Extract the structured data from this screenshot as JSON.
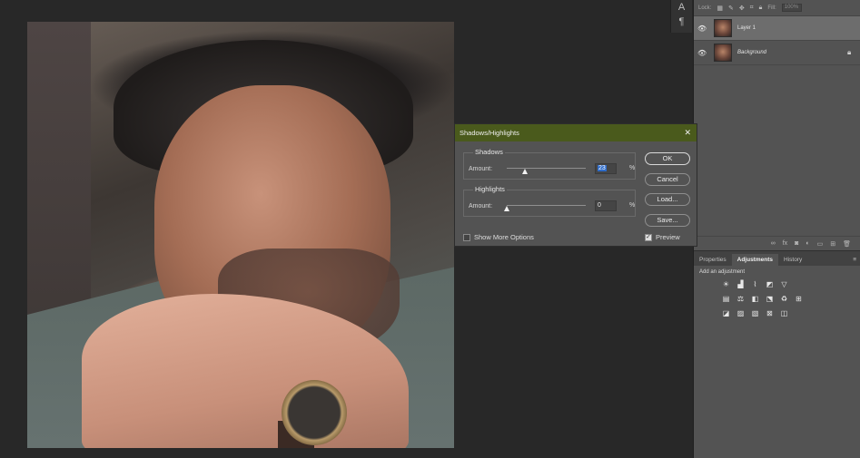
{
  "toolbar": {
    "icons": [
      "type-vertical-icon",
      "paragraph-icon"
    ],
    "glyphs": [
      "A",
      "¶"
    ]
  },
  "layers": {
    "lock_label": "Lock:",
    "fill_label": "Fill:",
    "fill_value": "100%",
    "items": [
      {
        "name": "Layer 1",
        "visible": true,
        "selected": true
      },
      {
        "name": "Background",
        "visible": true,
        "selected": false,
        "locked": true
      }
    ]
  },
  "panel_tabs": {
    "items": [
      "Properties",
      "Adjustments",
      "History"
    ],
    "active": "Adjustments"
  },
  "adjustments": {
    "heading": "Add an adjustment"
  },
  "dialog": {
    "title": "Shadows/Highlights",
    "shadows": {
      "label": "Shadows",
      "amount_label": "Amount:",
      "value": "23",
      "unit": "%",
      "level": 0.23
    },
    "highlights": {
      "label": "Highlights",
      "amount_label": "Amount:",
      "value": "0",
      "unit": "%",
      "level": 0.0
    },
    "buttons": {
      "ok": "OK",
      "cancel": "Cancel",
      "load": "Load...",
      "save": "Save..."
    },
    "show_more_options": {
      "label": "Show More Options",
      "checked": false
    },
    "preview": {
      "label": "Preview",
      "checked": true
    }
  }
}
